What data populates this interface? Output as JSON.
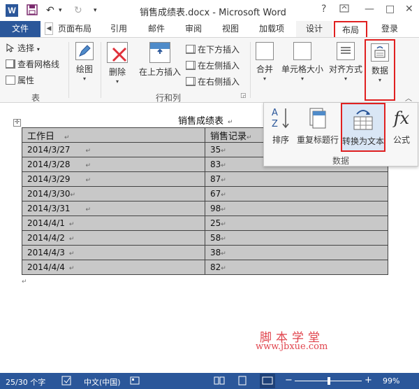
{
  "titlebar": {
    "app_logo": "W",
    "title": "销售成绩表.docx - Microsoft Word",
    "help": "?",
    "minimize": "—",
    "restore": "□",
    "close": "✕"
  },
  "tabs": {
    "file": "文件",
    "items": [
      "页面布局",
      "引用",
      "邮件",
      "审阅",
      "视图",
      "加载项",
      "设计",
      "布局"
    ],
    "login": "登录"
  },
  "ribbon": {
    "group_table": {
      "select": "选择",
      "view_gridlines": "查看网格线",
      "properties": "属性",
      "label": "表"
    },
    "draw": "绘图",
    "delete": "删除",
    "insert_above": "在上方插入",
    "insert_below": "在下方插入",
    "insert_left": "在左侧插入",
    "insert_right": "在右侧插入",
    "rows_cols_label": "行和列",
    "merge": "合并",
    "cell_size": "单元格大小",
    "alignment": "对齐方式",
    "data": "数据"
  },
  "data_panel": {
    "sort": "排序",
    "repeat_header": "重复标题行",
    "convert_to_text": "转换为文本",
    "formula": "公式",
    "formula_icon": "fx",
    "group_label": "数据"
  },
  "document": {
    "table_title": "销售成绩表",
    "headers": [
      "工作日",
      "销售记录"
    ],
    "rows": [
      [
        "2014/3/27",
        "35"
      ],
      [
        "2014/3/28",
        "83"
      ],
      [
        "2014/3/29",
        "87"
      ],
      [
        "2014/3/30",
        "67"
      ],
      [
        "2014/3/31",
        "98"
      ],
      [
        "2014/4/1",
        "25"
      ],
      [
        "2014/4/2",
        "58"
      ],
      [
        "2014/4/3",
        "38"
      ],
      [
        "2014/4/4",
        "82"
      ]
    ],
    "para_mark": "↵"
  },
  "watermark": {
    "line1": "脚本学堂",
    "line2": "www.jbxue.com"
  },
  "statusbar": {
    "word_count": "25/30 个字",
    "language": "中文(中国)",
    "zoom_minus": "−",
    "zoom_plus": "+",
    "zoom": "99%"
  },
  "colors": {
    "accent": "#2b579a",
    "highlight": "#e02020",
    "table_fill": "#c8c8c8",
    "watermark": "#e0434c"
  }
}
